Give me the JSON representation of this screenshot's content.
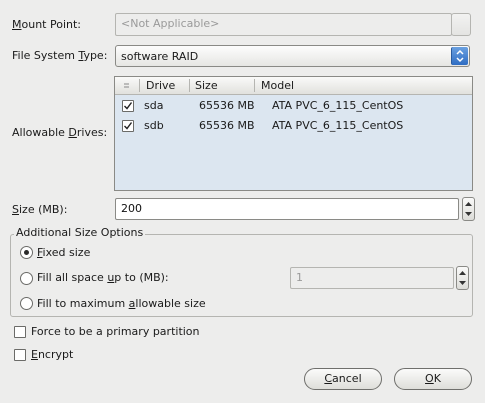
{
  "mount_point": {
    "label": "Mount Point:",
    "value": "<Not Applicable>"
  },
  "fs_type": {
    "label": "File System Type:",
    "value": "software RAID"
  },
  "drives": {
    "label": "Allowable Drives:",
    "columns": [
      "Drive",
      "Size",
      "Model"
    ],
    "rows": [
      {
        "checked": true,
        "drive": "sda",
        "size": "65536 MB",
        "model": "ATA PVC_6_115_CentOS"
      },
      {
        "checked": true,
        "drive": "sdb",
        "size": "65536 MB",
        "model": "ATA PVC_6_115_CentOS"
      }
    ]
  },
  "size": {
    "label": "Size (MB):",
    "value": "200"
  },
  "additional": {
    "title": "Additional Size Options",
    "options": [
      {
        "label": "Fixed size",
        "selected": true
      },
      {
        "label": "Fill all space up to (MB):",
        "selected": false
      },
      {
        "label": "Fill to maximum allowable size",
        "selected": false
      }
    ],
    "fill_up_value": "1"
  },
  "force_primary": {
    "label": "Force to be a primary partition",
    "checked": false
  },
  "encrypt": {
    "label": "Encrypt",
    "checked": false
  },
  "buttons": {
    "cancel": "Cancel",
    "ok": "OK"
  }
}
